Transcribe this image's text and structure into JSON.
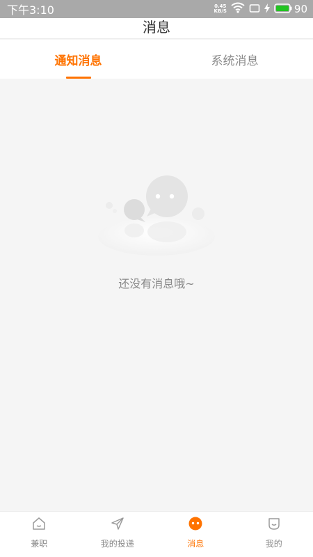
{
  "status_bar": {
    "time": "下午3:10",
    "net_speed_value": "0.45",
    "net_speed_unit": "KB/S",
    "battery": "90",
    "icons": [
      "wifi-icon",
      "screen-rotate-icon",
      "charging-icon",
      "battery-icon"
    ]
  },
  "header": {
    "title": "消息"
  },
  "tabs": [
    {
      "label": "通知消息",
      "active": true
    },
    {
      "label": "系统消息",
      "active": false
    }
  ],
  "empty_state": {
    "message": "还没有消息哦~",
    "icon": "chat-bubbles-illustration"
  },
  "bottom_nav": [
    {
      "label": "兼职",
      "icon": "home-icon",
      "active": false
    },
    {
      "label": "我的投递",
      "icon": "paper-plane-icon",
      "active": false
    },
    {
      "label": "消息",
      "icon": "message-icon",
      "active": true
    },
    {
      "label": "我的",
      "icon": "profile-icon",
      "active": false
    }
  ],
  "colors": {
    "accent": "#ff7300",
    "status_bar": "#a9a9a9",
    "background": "#f5f5f5",
    "inactive_text": "#8a8a8a",
    "battery_fill": "#22c422"
  }
}
